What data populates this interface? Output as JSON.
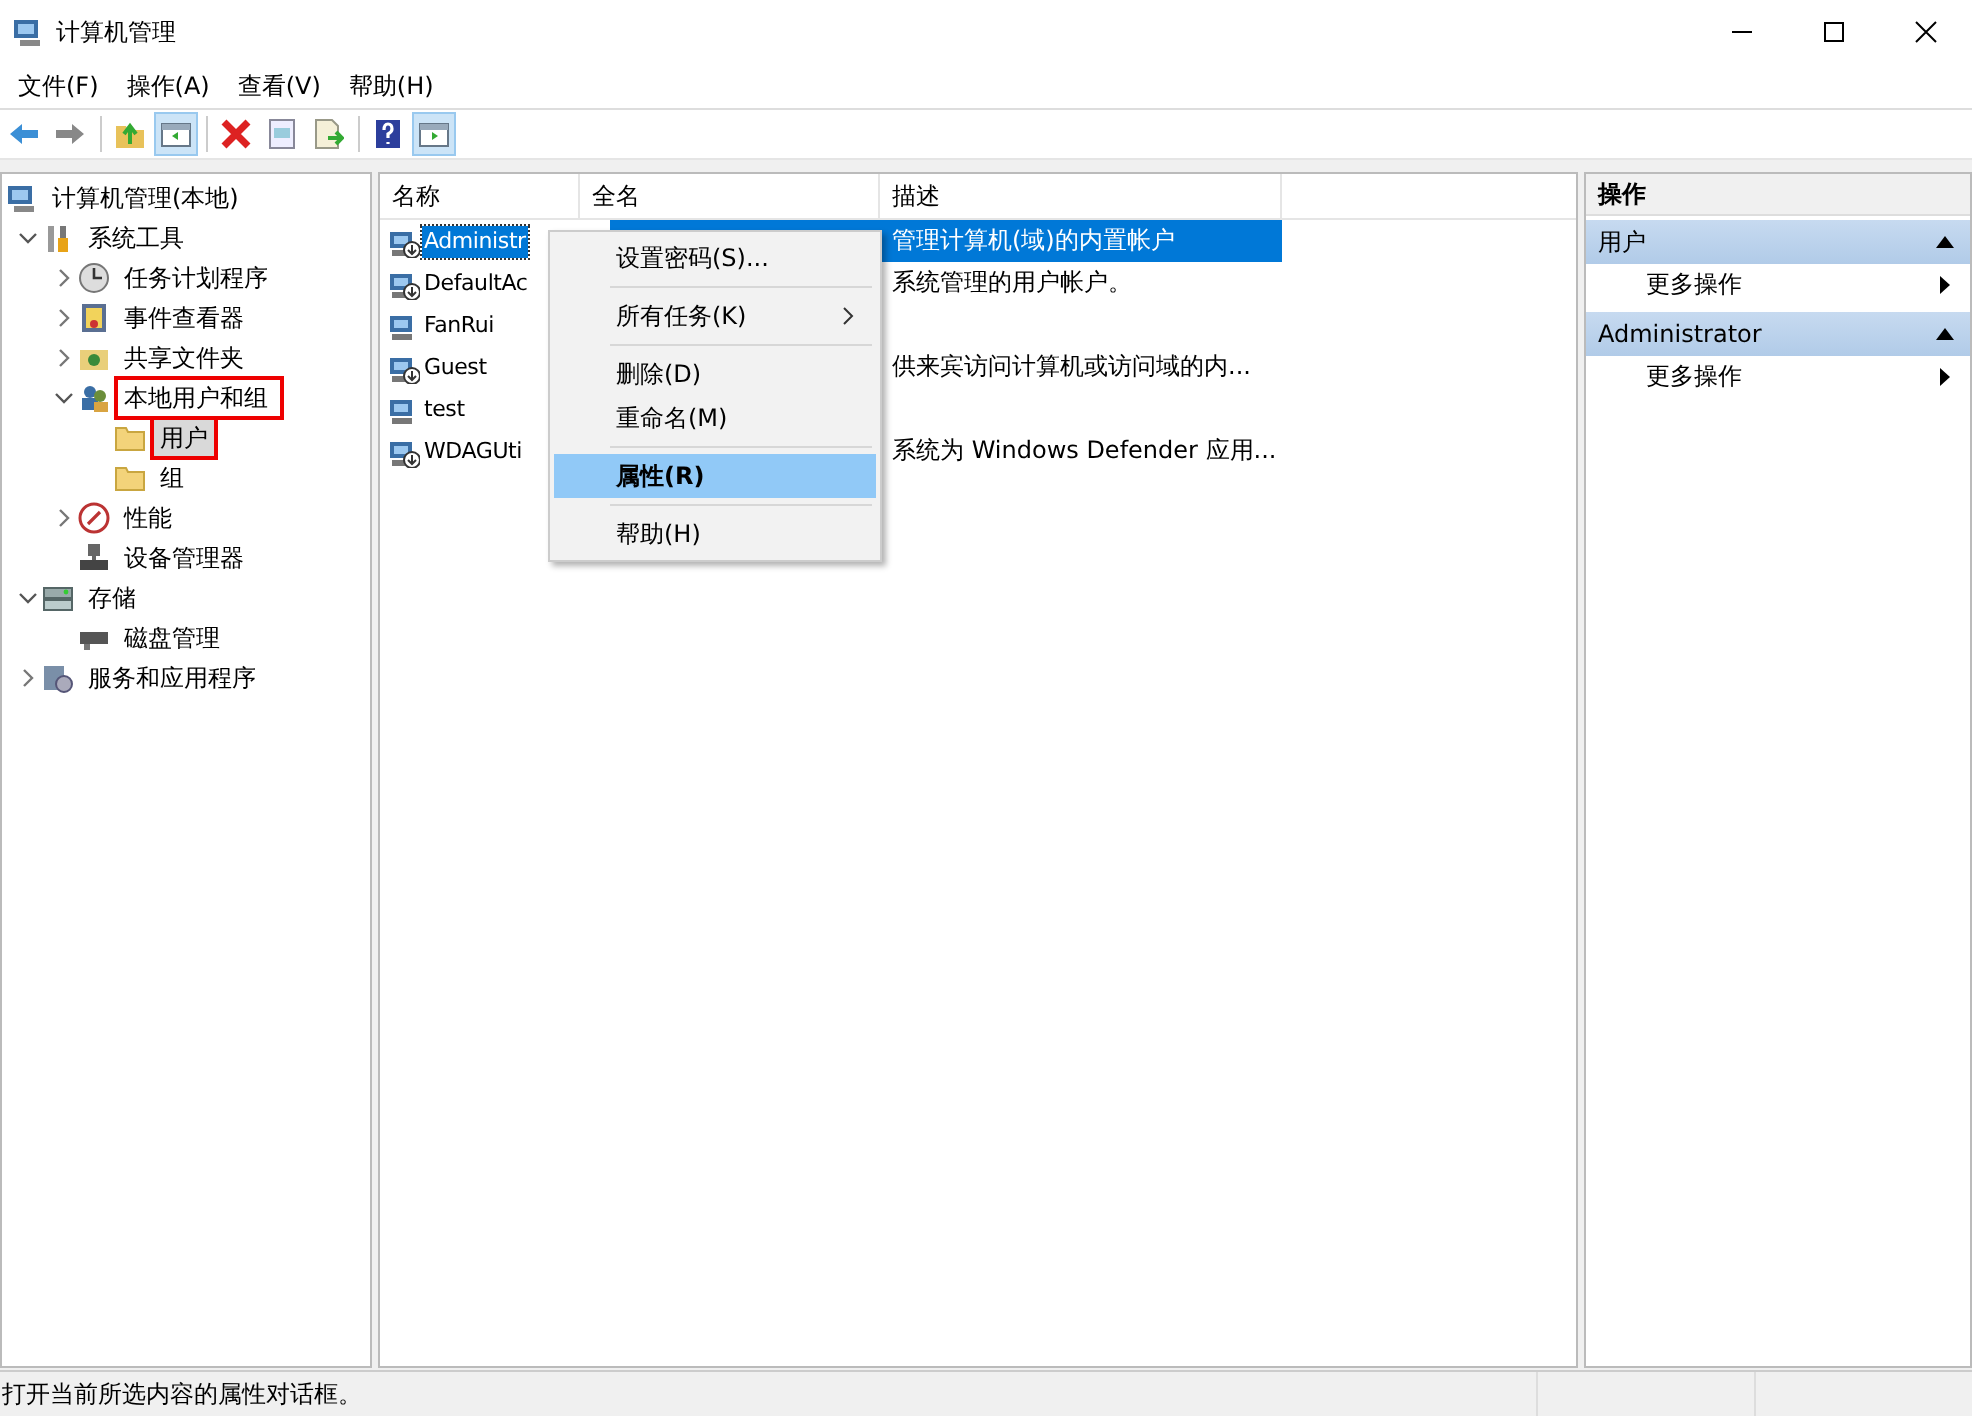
{
  "window": {
    "title": "计算机管理"
  },
  "menu": [
    "文件(F)",
    "操作(A)",
    "查看(V)",
    "帮助(H)"
  ],
  "toolbar": [
    {
      "kind": "back",
      "pressed": false
    },
    {
      "kind": "forward",
      "pressed": false
    },
    {
      "kind": "separator"
    },
    {
      "kind": "up",
      "pressed": false
    },
    {
      "kind": "tree",
      "pressed": true
    },
    {
      "kind": "separator"
    },
    {
      "kind": "delete",
      "pressed": false
    },
    {
      "kind": "properties",
      "pressed": false
    },
    {
      "kind": "export",
      "pressed": false
    },
    {
      "kind": "separator"
    },
    {
      "kind": "help",
      "pressed": false
    },
    {
      "kind": "actionpane",
      "pressed": true
    }
  ],
  "tree": [
    {
      "label": "计算机管理(本地)",
      "selected": false,
      "annotated": false,
      "children": [
        {
          "label": "系统工具",
          "expanded": true,
          "selected": false,
          "annotated": false,
          "children": [
            {
              "label": "任务计划程序",
              "expanded": false,
              "selected": false,
              "annotated": false
            },
            {
              "label": "事件查看器",
              "expanded": false,
              "selected": false,
              "annotated": false
            },
            {
              "label": "共享文件夹",
              "expanded": false,
              "selected": false,
              "annotated": false
            },
            {
              "label": "本地用户和组",
              "expanded": true,
              "selected": false,
              "annotated": true,
              "children": [
                {
                  "label": "用户",
                  "selected": true,
                  "annotated": true
                },
                {
                  "label": "组",
                  "selected": false,
                  "annotated": false
                }
              ]
            },
            {
              "label": "性能",
              "expanded": false,
              "selected": false,
              "annotated": false
            },
            {
              "label": "设备管理器",
              "selected": false,
              "annotated": false
            }
          ]
        },
        {
          "label": "存储",
          "expanded": true,
          "selected": false,
          "annotated": false,
          "children": [
            {
              "label": "磁盘管理",
              "selected": false,
              "annotated": false
            }
          ]
        },
        {
          "label": "服务和应用程序",
          "expanded": false,
          "selected": false,
          "annotated": false
        }
      ]
    }
  ],
  "table": {
    "columns": [
      "名称",
      "全名",
      "描述"
    ],
    "rows": [
      {
        "name": "Administr",
        "description": "管理计算机(域)的内置帐户",
        "selected": true,
        "disabled": true
      },
      {
        "name": "DefaultAc",
        "description": "系统管理的用户帐户。",
        "selected": false,
        "disabled": true
      },
      {
        "name": "FanRui",
        "description": "",
        "selected": false,
        "disabled": false
      },
      {
        "name": "Guest",
        "description": "供来宾访问计算机或访问域的内...",
        "selected": false,
        "disabled": true
      },
      {
        "name": "test",
        "description": "",
        "selected": false,
        "disabled": false
      },
      {
        "name": "WDAGUti",
        "description": "系统为 Windows Defender 应用...",
        "selected": false,
        "disabled": true
      }
    ]
  },
  "context_menu": [
    {
      "kind": "item",
      "label": "设置密码(S)...",
      "submenu": false,
      "default": false,
      "selected": false
    },
    {
      "kind": "separator"
    },
    {
      "kind": "item",
      "label": "所有任务(K)",
      "submenu": true,
      "default": false,
      "selected": false
    },
    {
      "kind": "separator"
    },
    {
      "kind": "item",
      "label": "删除(D)",
      "submenu": false,
      "default": false,
      "selected": false
    },
    {
      "kind": "item",
      "label": "重命名(M)",
      "submenu": false,
      "default": false,
      "selected": false
    },
    {
      "kind": "separator"
    },
    {
      "kind": "item",
      "label": "属性(R)",
      "submenu": false,
      "default": true,
      "selected": true
    },
    {
      "kind": "separator"
    },
    {
      "kind": "item",
      "label": "帮助(H)",
      "submenu": false,
      "default": false,
      "selected": false
    }
  ],
  "actions": {
    "title": "操作",
    "sections": [
      {
        "title": "用户",
        "items": [
          "更多操作"
        ]
      },
      {
        "title": "Administrator",
        "items": [
          "更多操作"
        ]
      }
    ]
  },
  "status_bar": {
    "text": "打开当前所选内容的属性对话框。"
  }
}
